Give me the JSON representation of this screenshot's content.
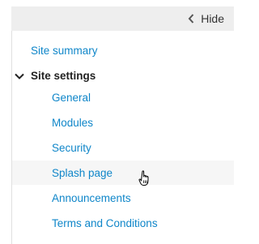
{
  "header": {
    "hide_label": "Hide"
  },
  "nav": {
    "site_summary": "Site summary",
    "site_settings": {
      "label": "Site settings",
      "items": [
        "General",
        "Modules",
        "Security",
        "Splash page",
        "Announcements",
        "Terms and Conditions"
      ]
    }
  },
  "colors": {
    "link": "#0f86c9",
    "top_bar": "#eeeeee",
    "hover_row": "#f6f6f6"
  }
}
